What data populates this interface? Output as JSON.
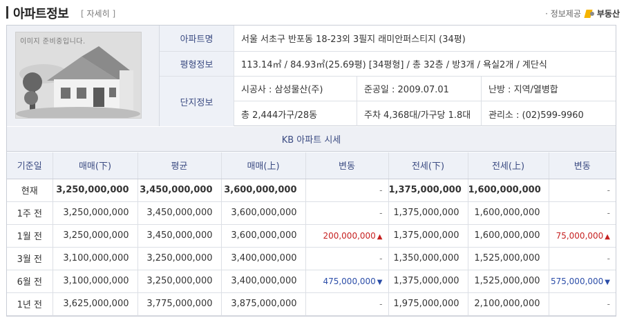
{
  "header": {
    "title": "아파트정보",
    "detail_open": "[",
    "detail_link": "자세히",
    "detail_close": "]",
    "provider_label": "· 정보제공",
    "provider_name": "부동산"
  },
  "photo": {
    "placeholder_text": "이미지 준비중입니다."
  },
  "info": {
    "apt_name_label": "아파트명",
    "apt_name": "서울 서초구 반포동 18-23외 3필지 래미안퍼스티지 (34평)",
    "area_label": "평형정보",
    "area": "113.14㎡ / 84.93㎡(25.69평) [34평형] / 총 32층 / 방3개 / 욕실2개 / 계단식",
    "complex_label": "단지정보",
    "builder": "시공사 : 삼성물산(주)",
    "completion": "준공일 : 2009.07.01",
    "heating": "난방 : 지역/열병합",
    "households": "총 2,444가구/28동",
    "parking": "주차 4,368대/가구당 1.8대",
    "management": "관리소 : (02)599-9960"
  },
  "kb": {
    "title": "KB 아파트 시세",
    "columns": [
      "기준일",
      "매매(下)",
      "평균",
      "매매(上)",
      "변동",
      "전세(下)",
      "전세(上)",
      "변동"
    ],
    "rows": [
      {
        "period": "현재",
        "sale_low": "3,250,000,000",
        "avg": "3,450,000,000",
        "sale_high": "3,600,000,000",
        "sale_change": "-",
        "sale_dir": "none",
        "jeonse_low": "1,375,000,000",
        "jeonse_high": "1,600,000,000",
        "jeonse_change": "-",
        "jeonse_dir": "none"
      },
      {
        "period": "1주 전",
        "sale_low": "3,250,000,000",
        "avg": "3,450,000,000",
        "sale_high": "3,600,000,000",
        "sale_change": "-",
        "sale_dir": "none",
        "jeonse_low": "1,375,000,000",
        "jeonse_high": "1,600,000,000",
        "jeonse_change": "-",
        "jeonse_dir": "none"
      },
      {
        "period": "1월 전",
        "sale_low": "3,250,000,000",
        "avg": "3,450,000,000",
        "sale_high": "3,600,000,000",
        "sale_change": "200,000,000",
        "sale_dir": "up",
        "jeonse_low": "1,375,000,000",
        "jeonse_high": "1,600,000,000",
        "jeonse_change": "75,000,000",
        "jeonse_dir": "up"
      },
      {
        "period": "3월 전",
        "sale_low": "3,100,000,000",
        "avg": "3,250,000,000",
        "sale_high": "3,400,000,000",
        "sale_change": "-",
        "sale_dir": "none",
        "jeonse_low": "1,350,000,000",
        "jeonse_high": "1,525,000,000",
        "jeonse_change": "-",
        "jeonse_dir": "none"
      },
      {
        "period": "6월 전",
        "sale_low": "3,100,000,000",
        "avg": "3,250,000,000",
        "sale_high": "3,400,000,000",
        "sale_change": "475,000,000",
        "sale_dir": "down",
        "jeonse_low": "1,375,000,000",
        "jeonse_high": "1,525,000,000",
        "jeonse_change": "575,000,000",
        "jeonse_dir": "down"
      },
      {
        "period": "1년 전",
        "sale_low": "3,625,000,000",
        "avg": "3,775,000,000",
        "sale_high": "3,875,000,000",
        "sale_change": "-",
        "sale_dir": "none",
        "jeonse_low": "1,975,000,000",
        "jeonse_high": "2,100,000,000",
        "jeonse_change": "-",
        "jeonse_dir": "none"
      }
    ]
  },
  "colors": {
    "label_text": "#3b4b82",
    "up": "#c62020",
    "down": "#2b4da8",
    "header_bg": "#eef1f7"
  }
}
